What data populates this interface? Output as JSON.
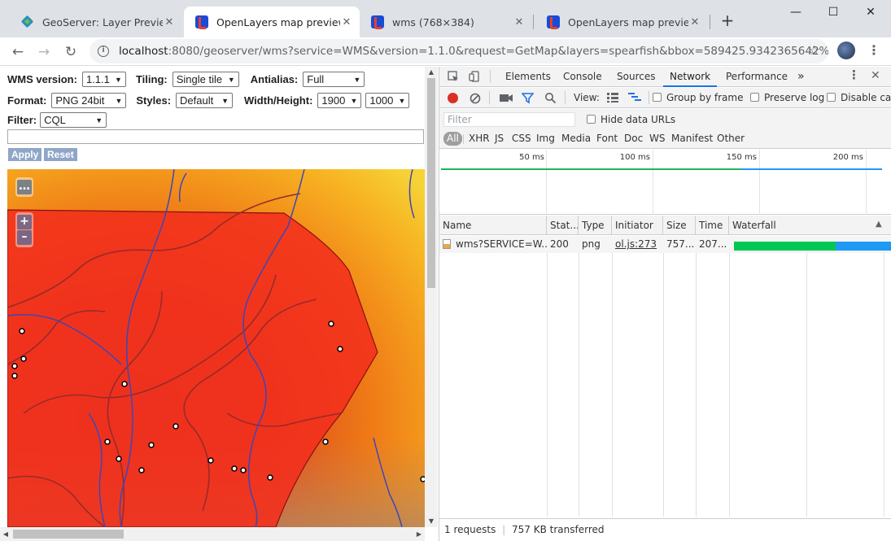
{
  "browser": {
    "tabs": [
      {
        "title": "GeoServer: Layer Preview",
        "icon": "geoserver-icon",
        "active": false
      },
      {
        "title": "OpenLayers map preview",
        "icon": "openlayers-icon",
        "active": true
      },
      {
        "title": "wms (768×384)",
        "icon": "openlayers-icon",
        "active": false
      },
      {
        "title": "OpenLayers map preview",
        "icon": "openlayers-icon",
        "active": false
      }
    ],
    "new_tab": "+",
    "url_host": "localhost",
    "url_rest": ":8080/geoserver/wms?service=WMS&version=1.1.0&request=GetMap&layers=spearfish&bbox=589425.9342365642%2C49..."
  },
  "form": {
    "wms_version_label": "WMS version:",
    "wms_version": "1.1.1",
    "tiling_label": "Tiling:",
    "tiling": "Single tile",
    "antialias_label": "Antialias:",
    "antialias": "Full",
    "format_label": "Format:",
    "format": "PNG 24bit",
    "styles_label": "Styles:",
    "styles": "Default",
    "wh_label": "Width/Height:",
    "width": "1900",
    "height": "1000",
    "filter_label": "Filter:",
    "filter_type": "CQL",
    "apply": "Apply",
    "reset": "Reset"
  },
  "map": {
    "more_button": "…",
    "zoom_in": "+",
    "zoom_out": "–"
  },
  "devtools": {
    "tabs": [
      "Elements",
      "Console",
      "Sources",
      "Network",
      "Performance"
    ],
    "active_tab": "Network",
    "more_tabs": "»",
    "view_label": "View:",
    "group_by_frame": "Group by frame",
    "preserve_log": "Preserve log",
    "disable_cache": "Disable cac",
    "filter_placeholder": "Filter",
    "hide_data_urls": "Hide data URLs",
    "types": [
      "All",
      "XHR",
      "JS",
      "CSS",
      "Img",
      "Media",
      "Font",
      "Doc",
      "WS",
      "Manifest",
      "Other"
    ],
    "timeline_ticks": [
      "50 ms",
      "100 ms",
      "150 ms",
      "200 ms"
    ],
    "columns": [
      "Name",
      "Stat...",
      "Type",
      "Initiator",
      "Size",
      "Time",
      "Waterfall"
    ],
    "rows": [
      {
        "name": "wms?SERVICE=W...",
        "status": "200",
        "type": "png",
        "initiator": "ol.js:273",
        "size": "757...",
        "time": "207..."
      }
    ],
    "status_requests": "1 requests",
    "status_transferred": "757 KB transferred",
    "colors": {
      "accent": "#1a73e8",
      "wait": "#00c853",
      "download": "#1e9af5",
      "record": "#d93025"
    }
  }
}
